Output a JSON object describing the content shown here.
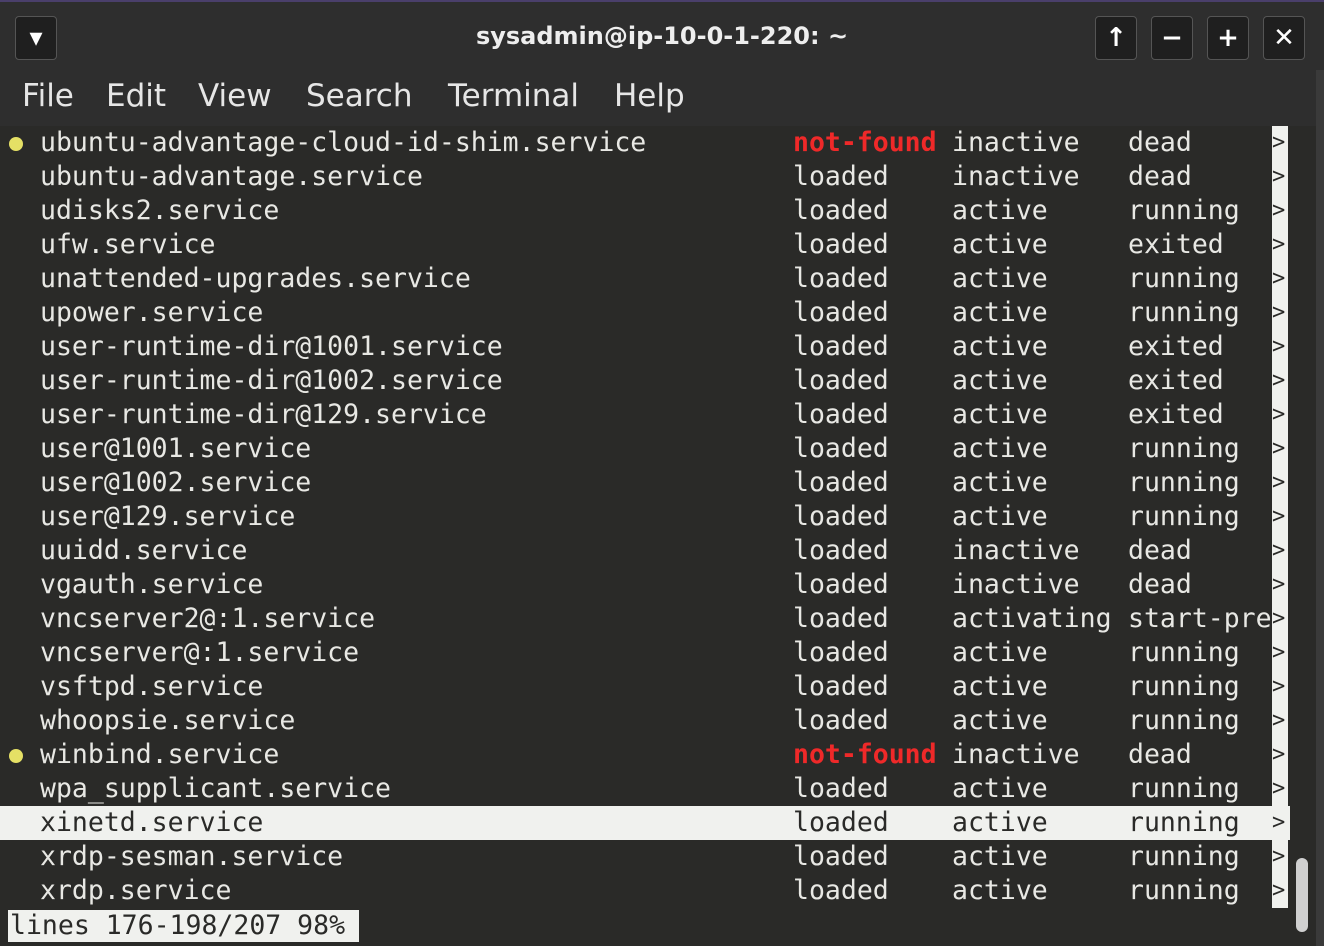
{
  "window": {
    "title": "sysadmin@ip-10-0-1-220: ~",
    "buttons": {
      "menu": "▾",
      "up": "↑",
      "minimize": "−",
      "maximize": "+",
      "close": "✕"
    }
  },
  "menubar": [
    "File",
    "Edit",
    "View",
    "Search",
    "Terminal",
    "Help"
  ],
  "colors": {
    "not_found": "#ef2929",
    "dot": "#e5e065",
    "background": "#2a2a28"
  },
  "rows": [
    {
      "unit": "ubuntu-advantage-cloud-id-shim.service",
      "load": "not-found",
      "active": "inactive",
      "sub": "dead",
      "dot": true
    },
    {
      "unit": "ubuntu-advantage.service",
      "load": "loaded",
      "active": "inactive",
      "sub": "dead"
    },
    {
      "unit": "udisks2.service",
      "load": "loaded",
      "active": "active",
      "sub": "running"
    },
    {
      "unit": "ufw.service",
      "load": "loaded",
      "active": "active",
      "sub": "exited"
    },
    {
      "unit": "unattended-upgrades.service",
      "load": "loaded",
      "active": "active",
      "sub": "running"
    },
    {
      "unit": "upower.service",
      "load": "loaded",
      "active": "active",
      "sub": "running"
    },
    {
      "unit": "user-runtime-dir@1001.service",
      "load": "loaded",
      "active": "active",
      "sub": "exited"
    },
    {
      "unit": "user-runtime-dir@1002.service",
      "load": "loaded",
      "active": "active",
      "sub": "exited"
    },
    {
      "unit": "user-runtime-dir@129.service",
      "load": "loaded",
      "active": "active",
      "sub": "exited"
    },
    {
      "unit": "user@1001.service",
      "load": "loaded",
      "active": "active",
      "sub": "running"
    },
    {
      "unit": "user@1002.service",
      "load": "loaded",
      "active": "active",
      "sub": "running"
    },
    {
      "unit": "user@129.service",
      "load": "loaded",
      "active": "active",
      "sub": "running"
    },
    {
      "unit": "uuidd.service",
      "load": "loaded",
      "active": "inactive",
      "sub": "dead"
    },
    {
      "unit": "vgauth.service",
      "load": "loaded",
      "active": "inactive",
      "sub": "dead"
    },
    {
      "unit": "vncserver2@:1.service",
      "load": "loaded",
      "active": "activating",
      "sub": "start-pre"
    },
    {
      "unit": "vncserver@:1.service",
      "load": "loaded",
      "active": "active",
      "sub": "running"
    },
    {
      "unit": "vsftpd.service",
      "load": "loaded",
      "active": "active",
      "sub": "running"
    },
    {
      "unit": "whoopsie.service",
      "load": "loaded",
      "active": "active",
      "sub": "running"
    },
    {
      "unit": "winbind.service",
      "load": "not-found",
      "active": "inactive",
      "sub": "dead",
      "dot": true
    },
    {
      "unit": "wpa_supplicant.service",
      "load": "loaded",
      "active": "active",
      "sub": "running"
    },
    {
      "unit": "xinetd.service",
      "load": "loaded",
      "active": "active",
      "sub": "running",
      "selected": true
    },
    {
      "unit": "xrdp-sesman.service",
      "load": "loaded",
      "active": "active",
      "sub": "running"
    },
    {
      "unit": "xrdp.service",
      "load": "loaded",
      "active": "active",
      "sub": "running"
    }
  ],
  "truncation_marker": ">",
  "status_line": "lines 176-198/207 98%"
}
